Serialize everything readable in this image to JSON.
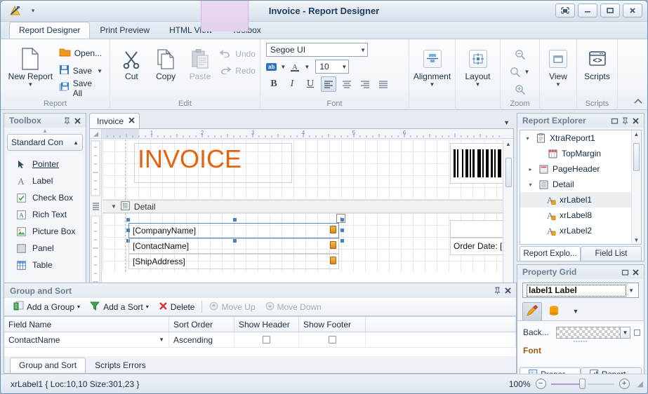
{
  "window": {
    "title": "Invoice - Report Designer",
    "app_icon": "report-designer-icon",
    "qat_caret": "▾",
    "controls": {
      "restore": "restore-window",
      "minimize": "minimize-window",
      "maximize": "maximize-window",
      "close": "close-window"
    }
  },
  "ribbon": {
    "tabs": [
      {
        "label": "Report Designer",
        "active": true
      },
      {
        "label": "Print Preview",
        "active": false
      },
      {
        "label": "HTML View",
        "active": false
      },
      {
        "label": "Toolbox",
        "active": false
      }
    ],
    "groups": {
      "report": {
        "label": "Report",
        "new_report": "New Report",
        "open": "Open...",
        "save": "Save",
        "save_all": "Save All"
      },
      "edit": {
        "label": "Edit",
        "cut": "Cut",
        "copy": "Copy",
        "paste": "Paste",
        "undo": "Undo",
        "redo": "Redo"
      },
      "font": {
        "label": "Font",
        "family": "Segoe UI",
        "size": "10",
        "bold": "B",
        "italic": "I",
        "underline": "U",
        "align_left": "align-left",
        "align_center": "align-center",
        "align_right": "align-right",
        "align_justify": "align-justify",
        "highlight": "ab",
        "fontcolor": "A"
      },
      "alignment": {
        "label": "Alignment"
      },
      "layout": {
        "label": "Layout"
      },
      "zoom": {
        "label": "Zoom"
      },
      "view": {
        "label": "View"
      },
      "scripts": {
        "label": "Scripts",
        "button": "Scripts"
      }
    }
  },
  "toolbox": {
    "title": "Toolbox",
    "group": "Standard Con",
    "items": [
      {
        "label": "Pointer",
        "icon": "pointer-icon"
      },
      {
        "label": "Label",
        "icon": "label-icon"
      },
      {
        "label": "Check Box",
        "icon": "checkbox-icon"
      },
      {
        "label": "Rich Text",
        "icon": "richtext-icon"
      },
      {
        "label": "Picture Box",
        "icon": "picturebox-icon"
      },
      {
        "label": "Panel",
        "icon": "panel-icon"
      },
      {
        "label": "Table",
        "icon": "table-icon"
      }
    ]
  },
  "designer": {
    "doc_tab": "Invoice",
    "ruler_marks": [
      "1",
      "2",
      "3",
      "4",
      "5"
    ],
    "report_title": "INVOICE",
    "band_detail": "Detail",
    "fields": [
      "[CompanyName]",
      "[ContactName]",
      "[ShipAddress]"
    ],
    "order_date": "Order Date: ["
  },
  "explorer": {
    "title": "Report Explorer",
    "tree": [
      {
        "label": "XtraReport1",
        "indent": 0,
        "expander": "▾",
        "icon": "report-icon",
        "selected": false
      },
      {
        "label": "TopMargin",
        "indent": 1,
        "expander": "",
        "icon": "topmargin-icon",
        "selected": false
      },
      {
        "label": "PageHeader",
        "indent": 1,
        "expander": "▸",
        "icon": "pageheader-icon",
        "selected": false
      },
      {
        "label": "Detail",
        "indent": 1,
        "expander": "▾",
        "icon": "detail-icon",
        "selected": false
      },
      {
        "label": "xrLabel1",
        "indent": 2,
        "expander": "",
        "icon": "label-field-icon",
        "selected": true
      },
      {
        "label": "xrLabel8",
        "indent": 2,
        "expander": "",
        "icon": "label-field-icon",
        "selected": false
      },
      {
        "label": "xrLabel2",
        "indent": 2,
        "expander": "",
        "icon": "label-field-icon",
        "selected": false
      }
    ],
    "tabs": [
      {
        "label": "Report Explo...",
        "active": true
      },
      {
        "label": "Field List",
        "active": false
      }
    ]
  },
  "property_grid": {
    "title": "Property Grid",
    "selected_object": "label1   Label",
    "toolbar": {
      "appearance": "brush-icon",
      "data": "database-icon",
      "more": "▾"
    },
    "rows": [
      {
        "name": "Back...",
        "value_type": "transparent-swatch"
      }
    ],
    "section": "Font",
    "tabs": [
      {
        "label": "Proper...",
        "active": true,
        "icon": "propertygrid-icon"
      },
      {
        "label": "Report...",
        "active": false,
        "icon": "reportgallery-icon"
      }
    ]
  },
  "group_sort": {
    "title": "Group and Sort",
    "toolbar": [
      {
        "label": "Add a Group",
        "caret": "▾",
        "icon": "add-group-icon",
        "disabled": false
      },
      {
        "label": "Add a Sort",
        "caret": "▾",
        "icon": "add-sort-icon",
        "disabled": false
      },
      {
        "label": "Delete",
        "caret": "",
        "icon": "delete-icon",
        "disabled": false
      },
      {
        "label": "Move Up",
        "caret": "",
        "icon": "move-up-icon",
        "disabled": true
      },
      {
        "label": "Move Down",
        "caret": "",
        "icon": "move-down-icon",
        "disabled": true
      }
    ],
    "columns": [
      "Field Name",
      "Sort Order",
      "Show Header",
      "Show Footer"
    ],
    "rows": [
      {
        "field_name": "ContactName",
        "sort_order": "Ascending",
        "show_header": false,
        "show_footer": false
      }
    ],
    "tabs": [
      {
        "label": "Group and Sort",
        "active": true
      },
      {
        "label": "Scripts Errors",
        "active": false
      }
    ]
  },
  "statusbar": {
    "text": "xrLabel1 { Loc:10,10 Size:301,23 }",
    "zoom": "100%",
    "zoom_out": "−",
    "zoom_in": "+"
  },
  "colors": {
    "accent_orange": "#e8620c",
    "title_blue": "#1b3a5c",
    "tab_highlight": "#ead9f2"
  }
}
